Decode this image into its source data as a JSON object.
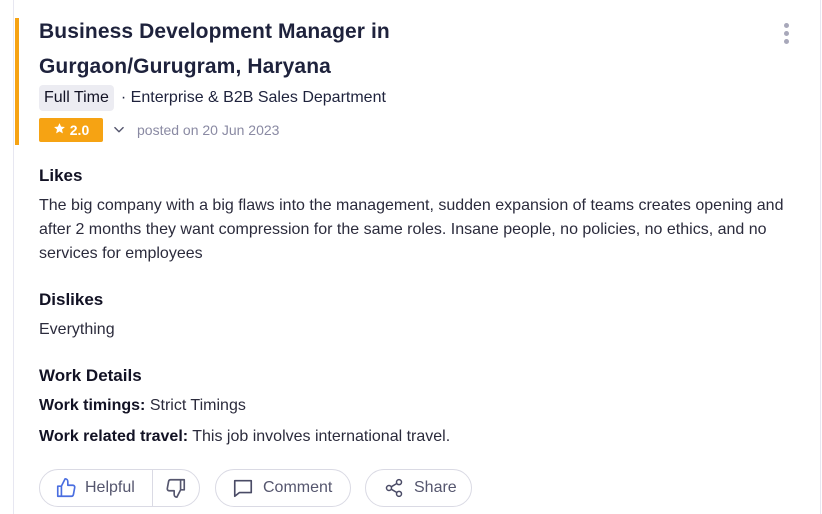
{
  "review": {
    "title": "Business Development Manager in Gurgaon/Gurugram, Haryana",
    "employment_type": "Full Time",
    "department": "· Enterprise & B2B Sales Department",
    "rating": "2.0",
    "posted": "posted on 20 Jun 2023",
    "rating_color": "#f6a313"
  },
  "sections": {
    "likes": {
      "title": "Likes",
      "text": "The big company with a big flaws into the management, sudden expansion of teams creates opening and after 2 months they want compression for the same roles. Insane people, no policies, no ethics, and no services for employees"
    },
    "dislikes": {
      "title": "Dislikes",
      "text": "Everything"
    },
    "work_details": {
      "title": "Work Details",
      "timings_label": "Work timings:",
      "timings_value": "Strict Timings",
      "travel_label": "Work related travel:",
      "travel_value": "This job involves international travel."
    }
  },
  "actions": {
    "helpful_label": "Helpful",
    "comment_label": "Comment",
    "share_label": "Share"
  },
  "icons": {
    "kebab": "more-vertical-icon",
    "star": "star-icon",
    "chevron": "chevron-down-icon",
    "thumbs_up": "thumbs-up-icon",
    "thumbs_down": "thumbs-down-icon",
    "comment": "comment-icon",
    "share": "share-icon"
  }
}
